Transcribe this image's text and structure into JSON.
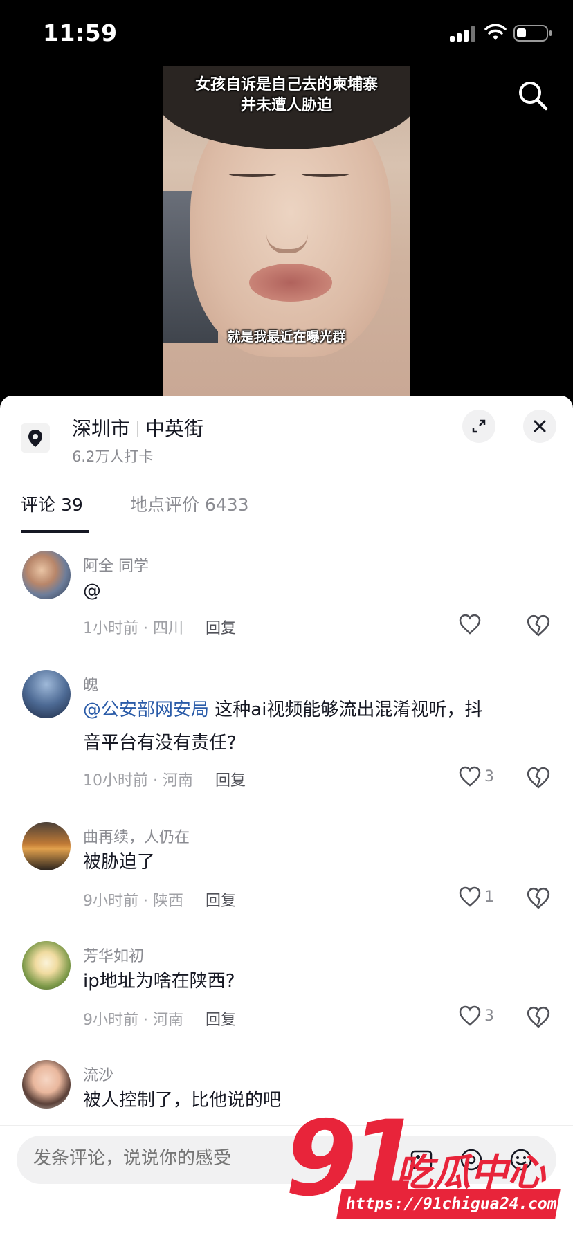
{
  "status_bar": {
    "time": "11:59"
  },
  "video": {
    "caption_top_1": "女孩自诉是自己去的柬埔寨",
    "caption_top_2": "并未遭人胁迫",
    "caption_bottom": "就是我最近在曝光群"
  },
  "location": {
    "city": "深圳市",
    "street": "中英街",
    "checkins": "6.2万人打卡"
  },
  "tabs": [
    {
      "label": "评论 39"
    },
    {
      "label": "地点评价 6433"
    }
  ],
  "comments": [
    {
      "user": "阿全 同学",
      "mention": "",
      "text": "@",
      "text2": "",
      "time_loc": "1小时前 · 四川",
      "reply": "回复",
      "likes": ""
    },
    {
      "user": "魄",
      "mention": "@公安部网安局",
      "text": " 这种ai视频能够流出混淆视听，抖",
      "text2": "音平台有没有责任?",
      "time_loc": "10小时前 · 河南",
      "reply": "回复",
      "likes": "3"
    },
    {
      "user": "曲再续，人仍在",
      "mention": "",
      "text": "被胁迫了",
      "text2": "",
      "time_loc": "9小时前 · 陕西",
      "reply": "回复",
      "likes": "1"
    },
    {
      "user": "芳华如初",
      "mention": "",
      "text": "ip地址为啥在陕西?",
      "text2": "",
      "time_loc": "9小时前 · 河南",
      "reply": "回复",
      "likes": "3"
    },
    {
      "user": "流沙",
      "mention": "",
      "text": "被人控制了，比他说的吧",
      "text2": "",
      "time_loc": "",
      "reply": "",
      "likes": ""
    }
  ],
  "input": {
    "placeholder": "发条评论，说说你的感受"
  },
  "watermark": {
    "number": "91",
    "text": "吃瓜中心",
    "url": "https://91chigua24.com"
  },
  "icons": {
    "search": "search-icon",
    "location": "location-pin-icon",
    "expand": "expand-icon",
    "close": "close-icon",
    "like": "heart-icon",
    "dislike": "broken-heart-icon"
  }
}
